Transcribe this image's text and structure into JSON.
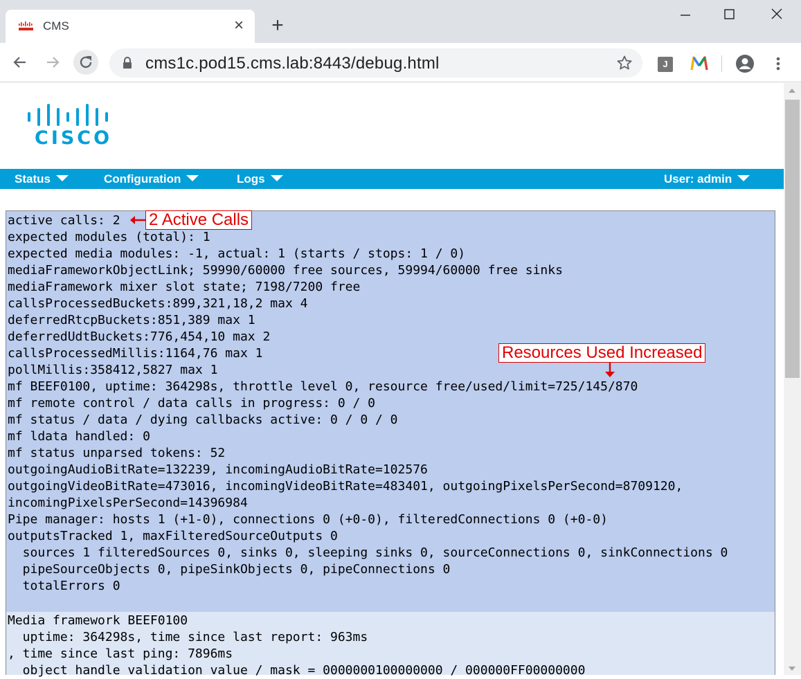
{
  "browser": {
    "tab_title": "CMS",
    "url": "cms1c.pod15.cms.lab:8443/debug.html",
    "extension_j_label": "J"
  },
  "page": {
    "logo_text": "CISCO",
    "nav": {
      "status": "Status",
      "configuration": "Configuration",
      "logs": "Logs",
      "user": "User: admin"
    },
    "debug_lines": [
      "active calls: 2",
      "expected modules (total): 1",
      "expected media modules: -1, actual: 1 (starts / stops: 1 / 0)",
      "mediaFrameworkObjectLink; 59990/60000 free sources, 59994/60000 free sinks",
      "mediaFramework mixer slot state; 7198/7200 free",
      "callsProcessedBuckets:899,321,18,2 max 4",
      "deferredRtcpBuckets:851,389 max 1",
      "deferredUdtBuckets:776,454,10 max 2",
      "callsProcessedMillis:1164,76 max 1",
      "pollMillis:358412,5827 max 1",
      "mf BEEF0100, uptime: 364298s, throttle level 0, resource free/used/limit=725/145/870",
      "mf remote control / data calls in progress: 0 / 0",
      "mf status / data / dying callbacks active: 0 / 0 / 0",
      "mf ldata handled: 0",
      "mf status unparsed tokens: 52",
      "outgoingAudioBitRate=132239, incomingAudioBitRate=102576",
      "outgoingVideoBitRate=473016, incomingVideoBitRate=483401, outgoingPixelsPerSecond=8709120,",
      "incomingPixelsPerSecond=14396984",
      "Pipe manager: hosts 1 (+1-0), connections 0 (+0-0), filteredConnections 0 (+0-0)",
      "outputsTracked 1, maxFilteredSourceOutputs 0",
      "  sources 1 filteredSources 0, sinks 0, sleeping sinks 0, sourceConnections 0, sinkConnections 0",
      "  pipeSourceObjects 0, pipeSinkObjects 0, pipeConnections 0",
      "  totalErrors 0"
    ],
    "media_lines": [
      "Media framework BEEF0100",
      "  uptime: 364298s, time since last report: 963ms",
      ", time since last ping: 7896ms",
      "  object handle validation value / mask = 0000000100000000 / 000000FF00000000"
    ],
    "annotations": {
      "active_calls": "2 Active Calls",
      "resources": "Resources Used Increased"
    }
  },
  "colors": {
    "cisco_blue": "#049fd9",
    "debug_bg": "#bccdee",
    "media_bg": "#dde6f5",
    "annotation_red": "#e00000"
  }
}
